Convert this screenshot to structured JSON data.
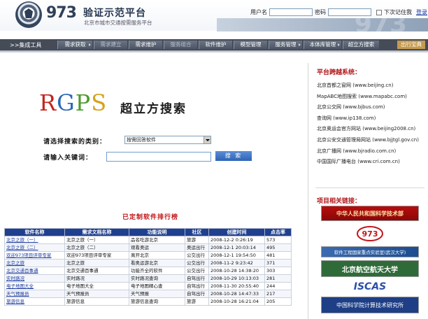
{
  "header": {
    "logo_number": "973",
    "logo_title": "验证示范平台",
    "logo_subtitle": "北京市城市交通按需服务平台",
    "login": {
      "username_label": "用户名",
      "password_label": "密码",
      "remember_label": "下次记住我",
      "login_link": "登录"
    }
  },
  "nav": {
    "brand": ">>集成工具",
    "items": [
      {
        "label": "需求获取",
        "dim": false,
        "arrow": true
      },
      {
        "label": "需求建立",
        "dim": true,
        "arrow": false
      },
      {
        "label": "需求维护",
        "dim": false,
        "arrow": false
      },
      {
        "label": "服务组合",
        "dim": true,
        "arrow": false
      },
      {
        "label": "软件维护",
        "dim": false,
        "arrow": false
      },
      {
        "label": "模型管理",
        "dim": false,
        "arrow": false
      },
      {
        "label": "服务管理",
        "dim": false,
        "arrow": true
      },
      {
        "label": "本体库管理",
        "dim": false,
        "arrow": true
      },
      {
        "label": "超立方搜索",
        "dim": false,
        "arrow": false
      }
    ],
    "exit_label": "出行宝典"
  },
  "search": {
    "logo_letters": [
      "R",
      "G",
      "P",
      "S"
    ],
    "logo_subtitle": "超立方搜索",
    "type_label": "请选择搜索的类别：",
    "type_selected": "按需回答软件",
    "keyword_label": "请输入关键词：",
    "keyword_value": "",
    "search_button": "搜  索"
  },
  "ranking": {
    "title": "已定制软件排行榜",
    "columns": [
      "软件名称",
      "需求文档名称",
      "功能说明",
      "社区",
      "创建时间",
      "点击率"
    ],
    "rows": [
      [
        "北京之旅（一）",
        "北京之旅（一）",
        "品名吃游北京",
        "旅游",
        "2008-12-2 0:26:19",
        "573"
      ],
      [
        "北京之旅（二）",
        "北京之旅（二）",
        "观看奥运",
        "奥运出行",
        "2008-12-1 20:03:14",
        "495"
      ],
      [
        "欢迎973项目评审专家",
        "欢迎973项目评审专家",
        "离开北京",
        "公交出行",
        "2008-12-1 19:54:50",
        "481"
      ],
      [
        "北京之旅",
        "北京之旅",
        "看奥运游北京",
        "公交出行",
        "2008-11-2 9:23:42",
        "371"
      ],
      [
        "北京交通百事通",
        "北京交通百事通",
        "功能齐全的软件",
        "公交出行",
        "2008-10-28 14:38:20",
        "303"
      ],
      [
        "实时路况",
        "实时路况",
        "实时路况查询",
        "自驾出行",
        "2008-10-29 10:13:03",
        "281"
      ],
      [
        "电子地图大全",
        "电子地图大全",
        "电子地图精心查",
        "自驾出行",
        "2008-11-30 20:55:40",
        "244"
      ],
      [
        "天气预报员",
        "天气预报员",
        "天气预报",
        "自驾出行",
        "2008-10-28 14:47:33",
        "217"
      ],
      [
        "旅游信息",
        "旅游信息",
        "旅游信息查询",
        "旅游",
        "2008-10-28 16:21:04",
        "205"
      ]
    ]
  },
  "sidebar": {
    "cross_title": "平台跨越系统：",
    "cross_links": [
      "北京首都之窗网 (www.beijing.cn)",
      "MapABC地图搜索 (www.mapabc.com)",
      "北京公交网 (www.bjbus.com)",
      "查询网 (www.ip138.com)",
      "北京奥运会官方网站 (www.beijing2008.cn)",
      "北京公安交通管理局网站 (www.bjjtgl.gov.cn)",
      "北京广播网 (www.bjradio.com.cn)",
      "中国国际广播电台 (www.cri.com.cn)"
    ],
    "related_title": "项目相关链接：",
    "partner_logos": {
      "nsfc": "中华人民共和国科学技术部",
      "p973": "973",
      "whu": "软件工程国家重点实验室(武汉大学)",
      "buaa": "北京航空航天大学",
      "iscas": "ISCAS",
      "ict": "中国科学院计算技术研究所"
    }
  }
}
